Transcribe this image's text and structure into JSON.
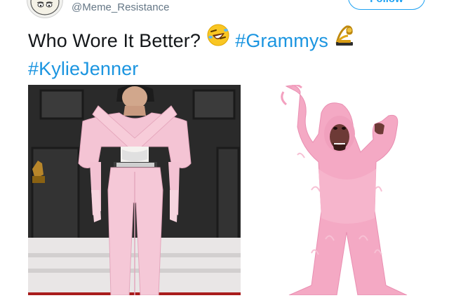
{
  "tweet": {
    "handle": "@Meme_Resistance",
    "follow_label": "Follow",
    "text_line1": "Who Wore It Better?",
    "hashtag_grammys": "#Grammys",
    "hashtag_kylie": "#KylieJenner"
  },
  "icons": {
    "avatar": "cartoon-face-avatar",
    "emoji_1": "rolling-on-floor-laughing-emoji",
    "emoji_2": "trophy-emoji"
  },
  "colors": {
    "link": "#1b95e0",
    "follow_border": "#1da1f2",
    "handle": "#657786",
    "pink": "#f3c6d6"
  }
}
